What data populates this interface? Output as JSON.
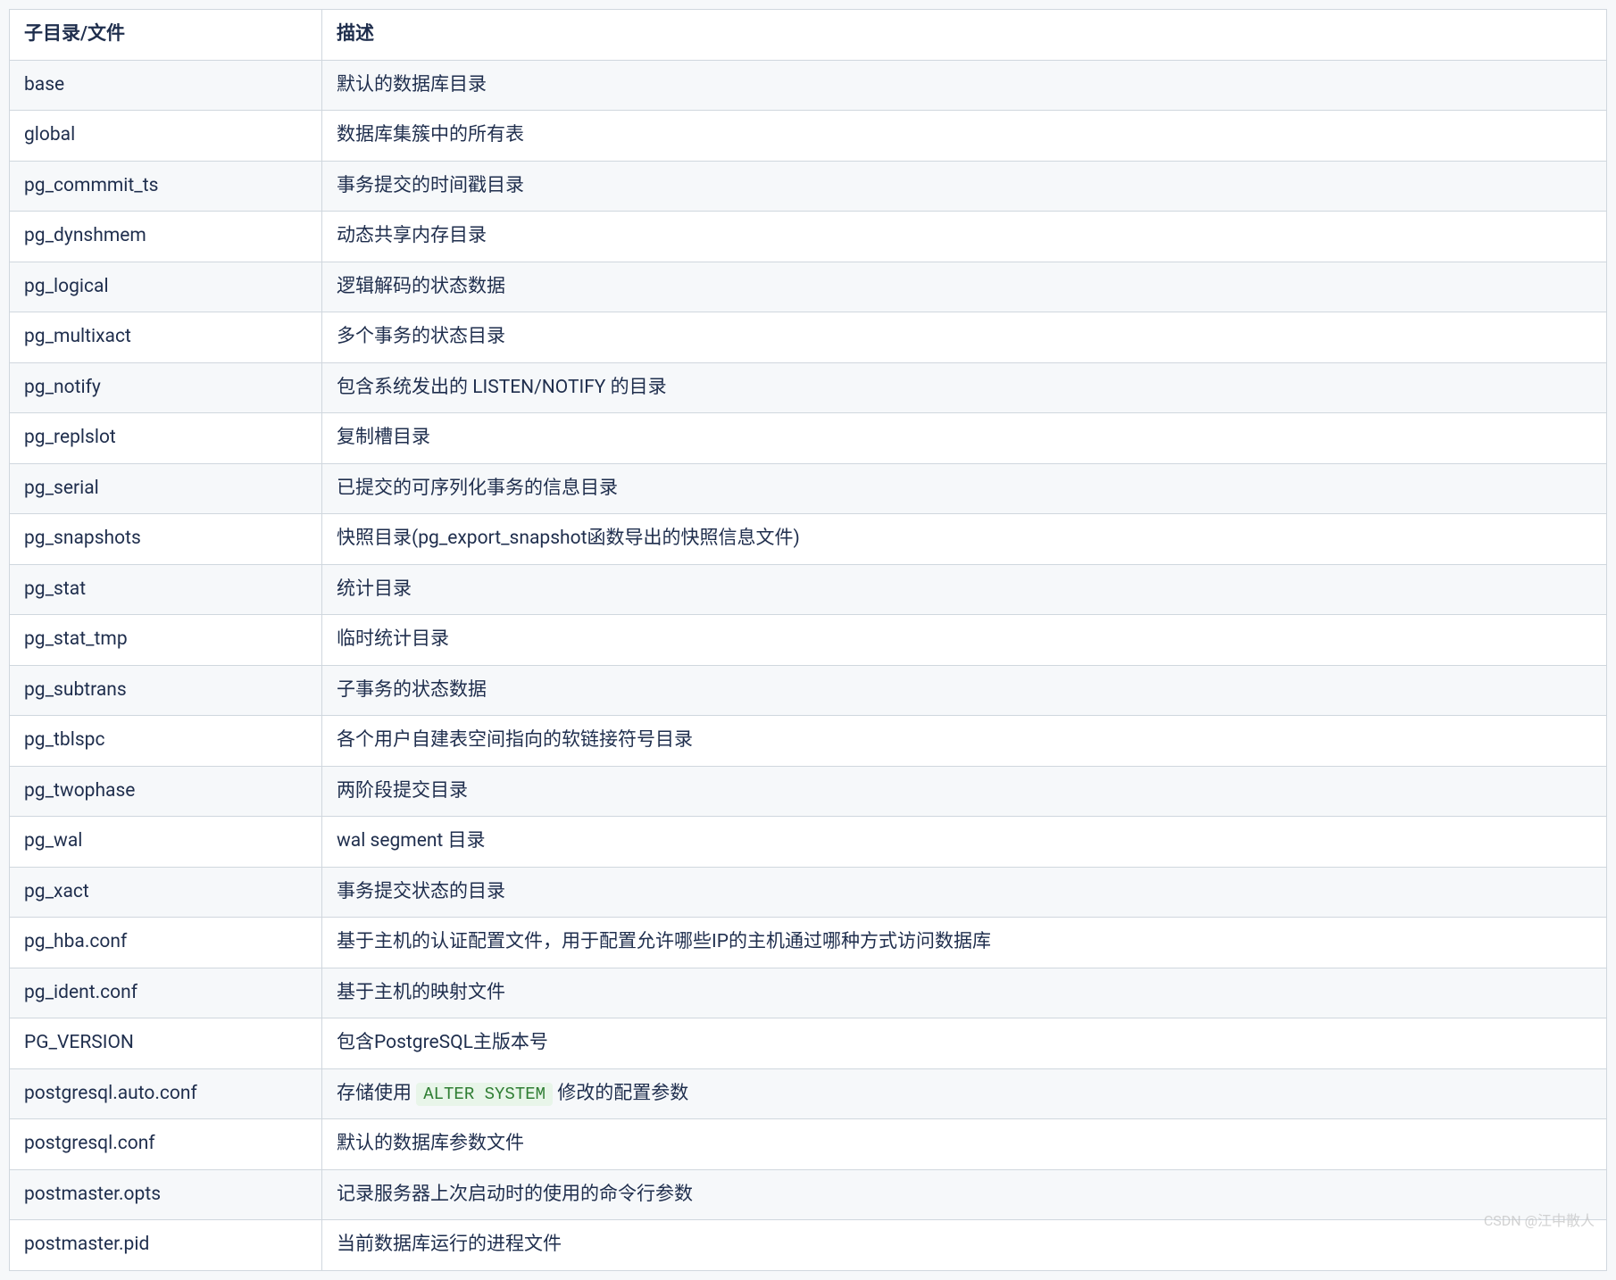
{
  "table": {
    "headers": [
      "子目录/文件",
      "描述"
    ],
    "rows": [
      {
        "name": "base",
        "desc": "默认的数据库目录"
      },
      {
        "name": "global",
        "desc": "数据库集簇中的所有表"
      },
      {
        "name": "pg_commmit_ts",
        "desc": "事务提交的时间戳目录"
      },
      {
        "name": "pg_dynshmem",
        "desc": "动态共享内存目录"
      },
      {
        "name": "pg_logical",
        "desc": "逻辑解码的状态数据"
      },
      {
        "name": "pg_multixact",
        "desc": "多个事务的状态目录"
      },
      {
        "name": "pg_notify",
        "desc": "包含系统发出的 LISTEN/NOTIFY 的目录"
      },
      {
        "name": "pg_replslot",
        "desc": "复制槽目录"
      },
      {
        "name": "pg_serial",
        "desc": "已提交的可序列化事务的信息目录"
      },
      {
        "name": "pg_snapshots",
        "desc": "快照目录(pg_export_snapshot函数导出的快照信息文件)"
      },
      {
        "name": "pg_stat",
        "desc": "统计目录"
      },
      {
        "name": "pg_stat_tmp",
        "desc": "临时统计目录"
      },
      {
        "name": "pg_subtrans",
        "desc": "子事务的状态数据"
      },
      {
        "name": "pg_tblspc",
        "desc": "各个用户自建表空间指向的软链接符号目录"
      },
      {
        "name": "pg_twophase",
        "desc": "两阶段提交目录"
      },
      {
        "name": "pg_wal",
        "desc": "wal segment 目录"
      },
      {
        "name": "pg_xact",
        "desc": "事务提交状态的目录"
      },
      {
        "name": "pg_hba.conf",
        "desc": "基于主机的认证配置文件，用于配置允许哪些IP的主机通过哪种方式访问数据库"
      },
      {
        "name": "pg_ident.conf",
        "desc": "基于主机的映射文件"
      },
      {
        "name": "PG_VERSION",
        "desc": "包含PostgreSQL主版本号"
      },
      {
        "name": "postgresql.auto.conf",
        "desc_pre": "存储使用 ",
        "code": "ALTER SYSTEM",
        "desc_post": " 修改的配置参数",
        "has_code": true
      },
      {
        "name": "postgresql.conf",
        "desc": "默认的数据库参数文件"
      },
      {
        "name": "postmaster.opts",
        "desc": "记录服务器上次启动时的使用的命令行参数"
      },
      {
        "name": "postmaster.pid",
        "desc": "当前数据库运行的进程文件"
      }
    ]
  },
  "watermark": "CSDN @江中散人"
}
